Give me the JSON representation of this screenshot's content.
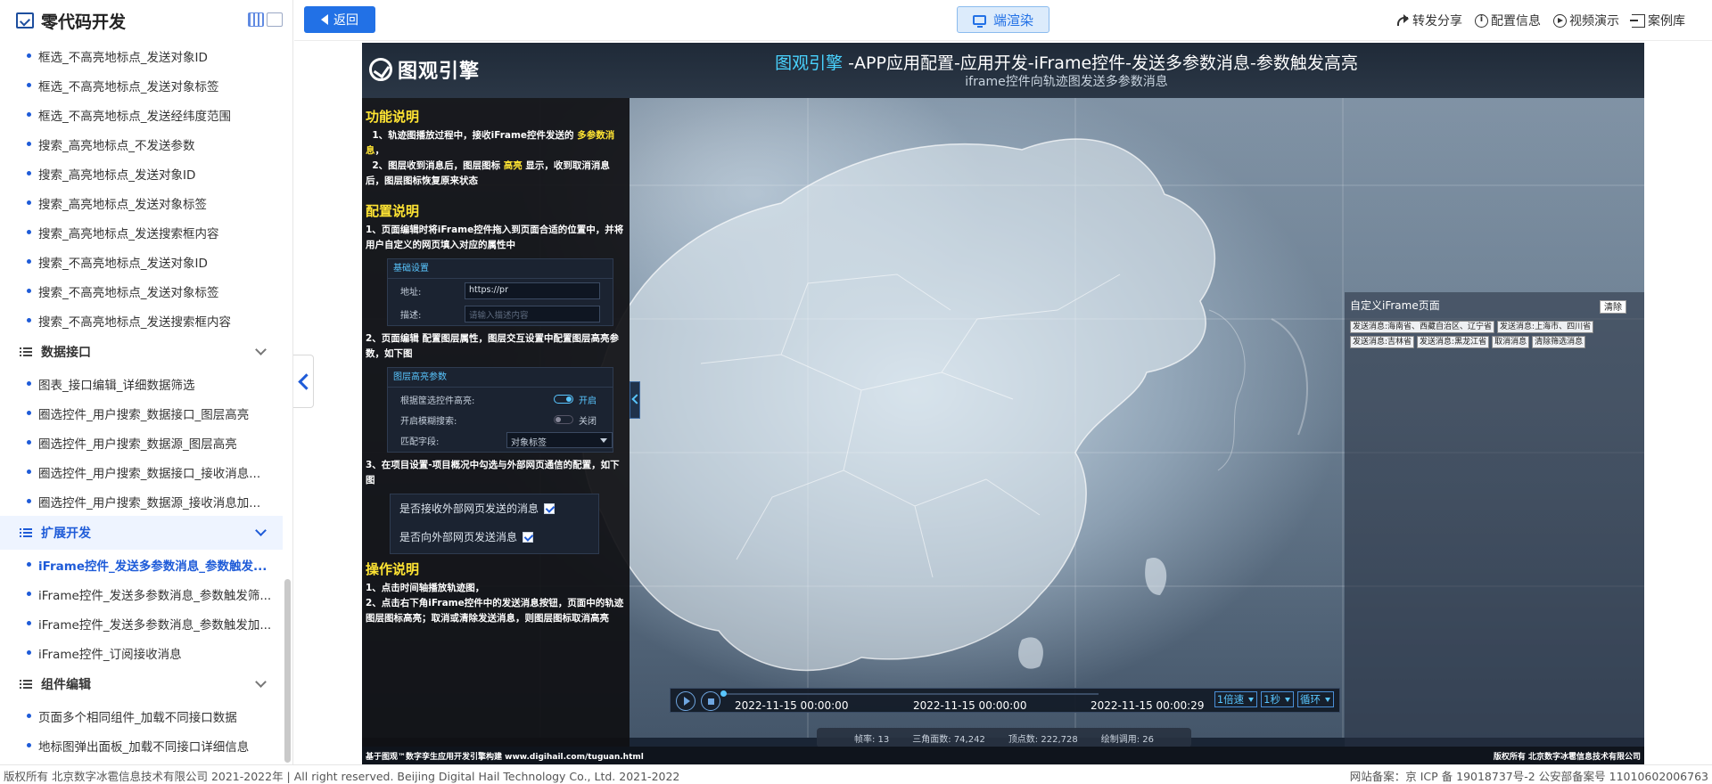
{
  "sidebar": {
    "title": "零代码开发",
    "items_before": [
      "框选_不高亮地标点_发送对象ID",
      "框选_不高亮地标点_发送对象标签",
      "框选_不高亮地标点_发送经纬度范围",
      "搜索_高亮地标点_不发送参数",
      "搜索_高亮地标点_发送对象ID",
      "搜索_高亮地标点_发送对象标签",
      "搜索_高亮地标点_发送搜索框内容",
      "搜索_不高亮地标点_发送对象ID",
      "搜索_不高亮地标点_发送对象标签",
      "搜索_不高亮地标点_发送搜索框内容"
    ],
    "group_data": "数据接口",
    "items_data": [
      "图表_接口编辑_详细数据筛选",
      "圈选控件_用户搜索_数据接口_图层高亮",
      "圈选控件_用户搜索_数据源_图层高亮",
      "圈选控件_用户搜索_数据接口_接收消息...",
      "圈选控件_用户搜索_数据源_接收消息加..."
    ],
    "group_ext": "扩展开发",
    "items_ext": [
      "iFrame控件_发送多参数消息_参数触发...",
      "iFrame控件_发送多参数消息_参数触发筛...",
      "iFrame控件_发送多参数消息_参数触发加...",
      "iFrame控件_订阅接收消息"
    ],
    "group_comp": "组件编辑",
    "items_comp": [
      "页面多个相同组件_加载不同接口数据",
      "地标图弹出面板_加载不同接口详细信息"
    ]
  },
  "topbar": {
    "back_label": "返回",
    "render_label": "端渲染",
    "share_label": "转发分享",
    "config_label": "配置信息",
    "video_label": "视频演示",
    "library_label": "案例库"
  },
  "canvas": {
    "brand": "图观引擎",
    "title_highlight": "图观引擎",
    "title_rest": " -APP应用配置-应用开发-iFrame控件-发送多参数消息-参数触发高亮",
    "subtitle": "iframe控件向轨迹图发送多参数消息",
    "info": {
      "h1": "功能说明",
      "p1a": "1、轨迹图播放过程中，接收iFrame控件发送的 ",
      "p1y": "多参数消息",
      "p1b": "，",
      "p2a": "2、图层收到消息后，图层图标 ",
      "p2y": "高亮",
      "p2b": " 显示，收到取消消息后，图层图标恢复原来状态",
      "h2": "配置说明",
      "p3": "1、页面编辑时将iFrame控件拖入到页面合适的位置中，并将用户自定义的网页填入对应的属性中",
      "box1_title": "基础设置",
      "box1_addr_label": "地址:",
      "box1_addr_value": "https://pr",
      "box1_desc_label": "描述:",
      "box1_desc_placeholder": "请输入描述内容",
      "p4": "2、页面编辑 配置图层属性，图层交互设置中配置图层高亮参数，如下图",
      "box2_title": "图层高亮参数",
      "box2_r1_label": "根据筐选控件高亮:",
      "box2_r1_state": "开启",
      "box2_r2_label": "开启模糊搜索:",
      "box2_r2_state": "关闭",
      "box2_r3_label": "匹配字段:",
      "box2_r3_value": "对象标签",
      "p5": "3、在项目设置-项目概况中勾选与外部网页通信的配置，如下图",
      "check1": "是否接收外部网页发送的消息",
      "check2": "是否向外部网页发送消息",
      "h3": "操作说明",
      "p6": "1、点击时间轴播放轨迹图，",
      "p7": "2、点击右下角iFrame控件中的发送消息按钮，页面中的轨迹图层图标高亮；取消或清除发送消息，则图层图标取消高亮"
    },
    "iframe": {
      "title": "自定义iFrame页面",
      "clear": "清除",
      "buttons": [
        "发送消息:海南省、西藏自治区、辽宁省",
        "发送消息:上海市、四川省",
        "发送消息:吉林省",
        "发送消息:黑龙江省",
        "取消消息",
        "清除筛选消息"
      ]
    },
    "timeline": {
      "t_start": "2022-11-15 00:00:00",
      "t_current": "2022-11-15 00:00:00",
      "t_end": "2022-11-15 00:00:29",
      "speed": "1倍速",
      "step": "1秒",
      "mode": "循环",
      "progress": 0
    },
    "stats": {
      "fps": "帧率:  13",
      "tris": "三角面数:  74,242",
      "verts": "顶点数:  222,728",
      "draws": "绘制调用:  26"
    },
    "foot_left": "基于图观™数字孪生应用开发引擎构建 www.digihail.com/tuguan.html",
    "foot_right": "版权所有 北京数字冰雹信息技术有限公司"
  },
  "footer": {
    "left": "版权所有 北京数字冰雹信息技术有限公司 2021-2022年 | All right reserved. Beijing Digital Hail Technology Co., Ltd. 2021-2022",
    "right": "网站备案：京 ICP 备 19018737号-2 公安部备案号 11010602006763"
  },
  "colors": {
    "accent": "#1e5bd8",
    "highlight_yellow": "#ffe433",
    "title_cyan": "#49d3ff"
  }
}
